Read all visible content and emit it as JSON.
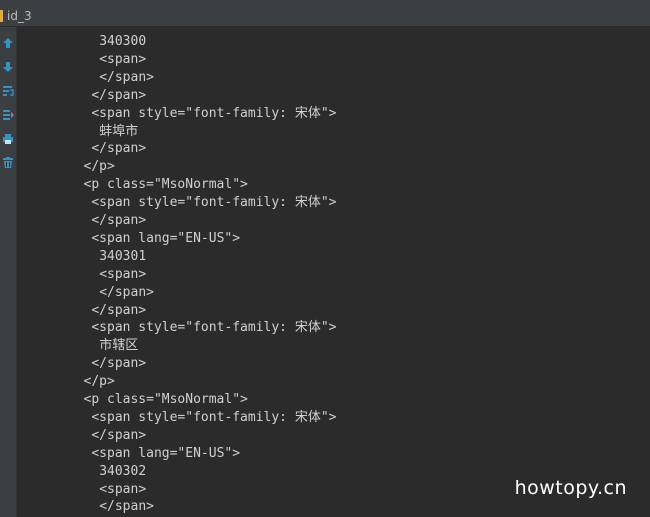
{
  "tab": {
    "label": "id_3",
    "marker_color": "#e0a94a"
  },
  "toolbar": [
    {
      "name": "up-arrow-icon",
      "glyph": "up"
    },
    {
      "name": "down-arrow-icon",
      "glyph": "down"
    },
    {
      "name": "wrap-lines-icon",
      "glyph": "wrap"
    },
    {
      "name": "soft-wrap-icon",
      "glyph": "softwrap"
    },
    {
      "name": "print-icon",
      "glyph": "print"
    },
    {
      "name": "delete-icon",
      "glyph": "trash"
    }
  ],
  "code_lines": [
    {
      "indent": 12,
      "text": "340300"
    },
    {
      "indent": 12,
      "text": "<span>"
    },
    {
      "indent": 12,
      "text": "</span>"
    },
    {
      "indent": 11,
      "text": "</span>"
    },
    {
      "indent": 11,
      "text": "<span style=\"font-family: 宋体\">"
    },
    {
      "indent": 12,
      "text": "蚌埠市"
    },
    {
      "indent": 11,
      "text": "</span>"
    },
    {
      "indent": 10,
      "text": "</p>"
    },
    {
      "indent": 10,
      "text": "<p class=\"MsoNormal\">"
    },
    {
      "indent": 11,
      "text": "<span style=\"font-family: 宋体\">"
    },
    {
      "indent": 11,
      "text": "</span>"
    },
    {
      "indent": 11,
      "text": "<span lang=\"EN-US\">"
    },
    {
      "indent": 12,
      "text": "340301"
    },
    {
      "indent": 12,
      "text": "<span>"
    },
    {
      "indent": 12,
      "text": "</span>"
    },
    {
      "indent": 11,
      "text": "</span>"
    },
    {
      "indent": 11,
      "text": "<span style=\"font-family: 宋体\">"
    },
    {
      "indent": 12,
      "text": "市辖区"
    },
    {
      "indent": 11,
      "text": "</span>"
    },
    {
      "indent": 10,
      "text": "</p>"
    },
    {
      "indent": 10,
      "text": "<p class=\"MsoNormal\">"
    },
    {
      "indent": 11,
      "text": "<span style=\"font-family: 宋体\">"
    },
    {
      "indent": 11,
      "text": "</span>"
    },
    {
      "indent": 11,
      "text": "<span lang=\"EN-US\">"
    },
    {
      "indent": 12,
      "text": "340302"
    },
    {
      "indent": 12,
      "text": "<span>"
    },
    {
      "indent": 12,
      "text": "</span>"
    }
  ],
  "watermark": "howtopy.cn",
  "colors": {
    "icon_blue": "#3592c4",
    "icon_purple": "#9876aa",
    "text": "#d0d0d0",
    "background": "#2b2b2b"
  }
}
